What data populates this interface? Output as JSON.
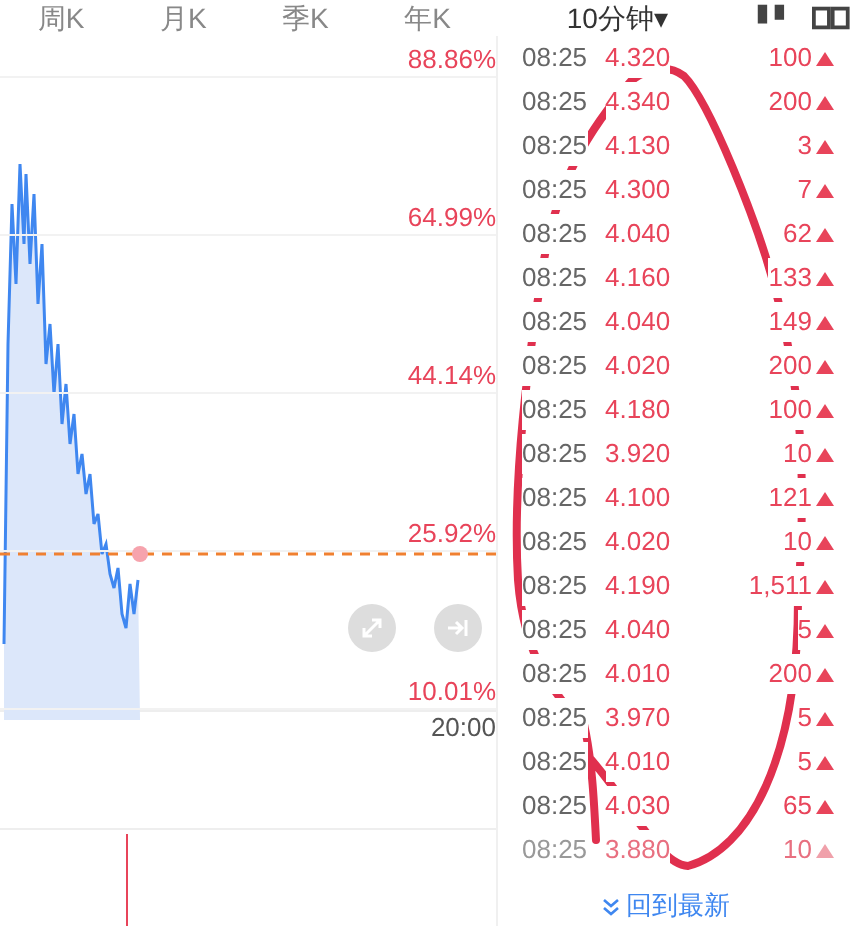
{
  "tabs": [
    {
      "label": "周K",
      "selected": false
    },
    {
      "label": "月K",
      "selected": false
    },
    {
      "label": "季K",
      "selected": false
    },
    {
      "label": "年K",
      "selected": false
    },
    {
      "label": "10分钟▾",
      "selected": true
    }
  ],
  "chart": {
    "axis_labels": [
      "88.86%",
      "64.99%",
      "44.14%",
      "25.92%",
      "10.01%"
    ],
    "time_label": "20:00"
  },
  "trades": [
    {
      "time": "08:25",
      "price": "4.320",
      "volume": "100",
      "faded": false
    },
    {
      "time": "08:25",
      "price": "4.340",
      "volume": "200",
      "faded": false
    },
    {
      "time": "08:25",
      "price": "4.130",
      "volume": "3",
      "faded": false
    },
    {
      "time": "08:25",
      "price": "4.300",
      "volume": "7",
      "faded": false
    },
    {
      "time": "08:25",
      "price": "4.040",
      "volume": "62",
      "faded": false
    },
    {
      "time": "08:25",
      "price": "4.160",
      "volume": "133",
      "faded": false
    },
    {
      "time": "08:25",
      "price": "4.040",
      "volume": "149",
      "faded": false
    },
    {
      "time": "08:25",
      "price": "4.020",
      "volume": "200",
      "faded": false
    },
    {
      "time": "08:25",
      "price": "4.180",
      "volume": "100",
      "faded": false
    },
    {
      "time": "08:25",
      "price": "3.920",
      "volume": "10",
      "faded": false
    },
    {
      "time": "08:25",
      "price": "4.100",
      "volume": "121",
      "faded": false
    },
    {
      "time": "08:25",
      "price": "4.020",
      "volume": "10",
      "faded": false
    },
    {
      "time": "08:25",
      "price": "4.190",
      "volume": "1,511",
      "faded": false
    },
    {
      "time": "08:25",
      "price": "4.040",
      "volume": "5",
      "faded": false
    },
    {
      "time": "08:25",
      "price": "4.010",
      "volume": "200",
      "faded": false
    },
    {
      "time": "08:25",
      "price": "3.970",
      "volume": "5",
      "faded": false
    },
    {
      "time": "08:25",
      "price": "4.010",
      "volume": "5",
      "faded": false
    },
    {
      "time": "08:25",
      "price": "4.030",
      "volume": "65",
      "faded": false
    },
    {
      "time": "08:25",
      "price": "3.880",
      "volume": "10",
      "faded": true
    }
  ],
  "back_to_latest": {
    "label": "回到最新"
  }
}
